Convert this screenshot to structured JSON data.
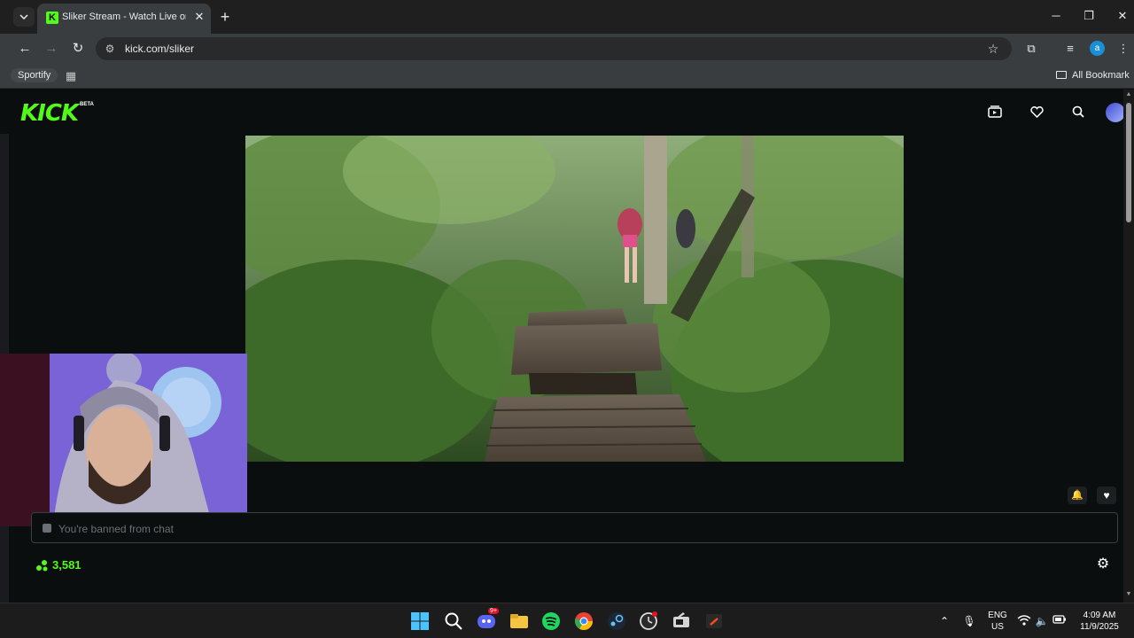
{
  "browser": {
    "tab_title": "Sliker Stream - Watch Live on Kick",
    "tab_favicon_letter": "K",
    "new_tab_glyph": "+",
    "url": "kick.com/sliker",
    "window_controls": [
      "minimize",
      "restore",
      "close"
    ]
  },
  "bookmarks": {
    "items": [
      "Sportify"
    ],
    "all_bookmarks_label": "All Bookmark"
  },
  "kick": {
    "logo_text": "KICK",
    "logo_badge": "BETA",
    "header_icons": [
      "subscriptions-icon",
      "following-heart-icon",
      "search-icon",
      "user-avatar"
    ],
    "brand_color": "#53fc18"
  },
  "stream": {
    "chat_placeholder": "You're banned from chat",
    "viewer_count": "3,581"
  },
  "taskbar": {
    "apps": [
      "windows-start",
      "search",
      "discord",
      "file-explorer",
      "spotify",
      "chrome",
      "steam",
      "clock-app",
      "media-app",
      "shell-app"
    ],
    "discord_badge": "9+",
    "language_line1": "ENG",
    "language_line2": "US",
    "time": "4:09 AM",
    "date": "11/9/2025"
  }
}
